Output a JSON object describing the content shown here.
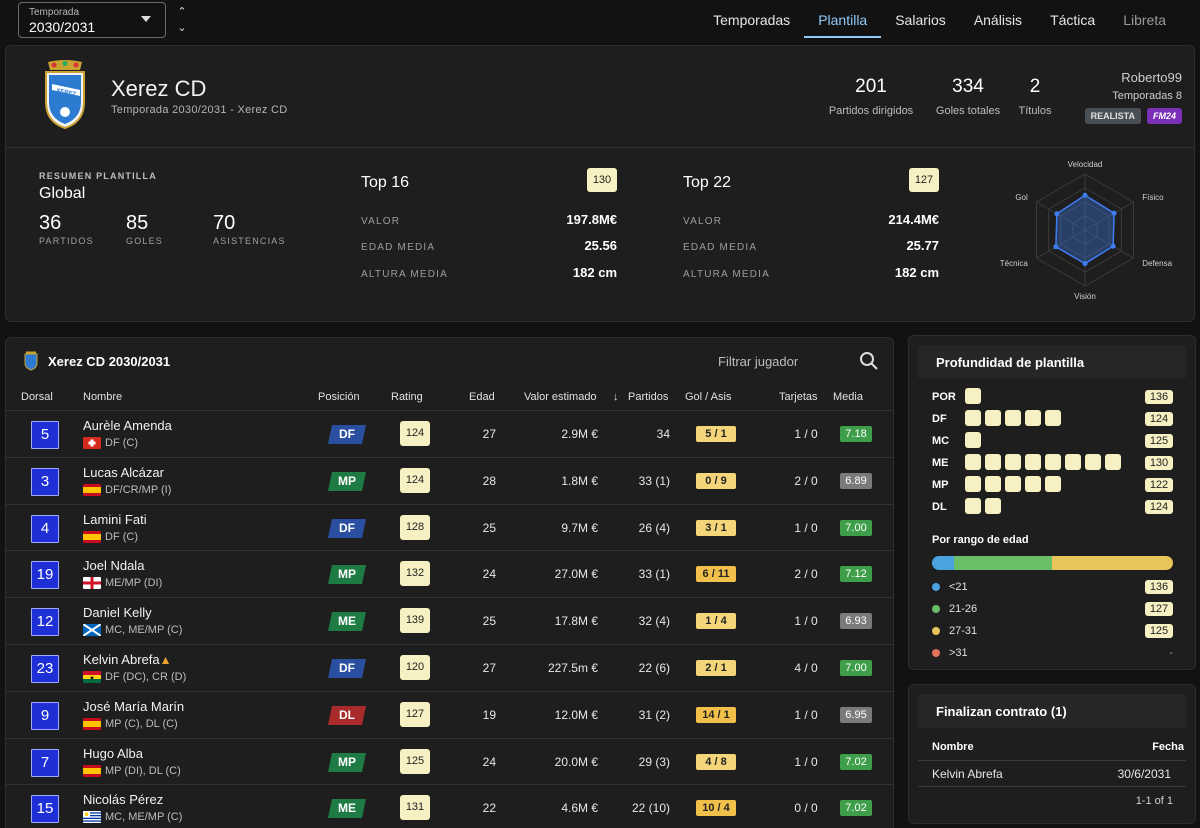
{
  "season": {
    "label": "Temporada",
    "value": "2030/2031"
  },
  "nav": [
    "Temporadas",
    "Plantilla",
    "Salarios",
    "Análisis",
    "Táctica",
    "Libreta"
  ],
  "club": {
    "name": "Xerez CD",
    "subtitle": "Temporada 2030/2031 - Xerez CD",
    "crest_text": "XEREZ"
  },
  "stats": [
    {
      "value": "201",
      "label": "Partidos dirigidos"
    },
    {
      "value": "334",
      "label": "Goles totales"
    },
    {
      "value": "2",
      "label": "Títulos"
    }
  ],
  "user": {
    "name": "Roberto99",
    "seasons": "Temporadas 8",
    "badges": [
      "REALISTA",
      "FM24"
    ]
  },
  "summary": {
    "caption": "RESUMEN PLANTILLA",
    "title": "Global",
    "stats": [
      {
        "value": "36",
        "label": "PARTIDOS"
      },
      {
        "value": "85",
        "label": "GOLES"
      },
      {
        "value": "70",
        "label": "ASISTENCIAS"
      }
    ]
  },
  "tops": [
    {
      "title": "Top 16",
      "rating": "130",
      "rows": [
        {
          "k": "VALOR",
          "v": "197.8M€"
        },
        {
          "k": "EDAD MEDIA",
          "v": "25.56"
        },
        {
          "k": "ALTURA MEDIA",
          "v": "182 cm"
        }
      ]
    },
    {
      "title": "Top 22",
      "rating": "127",
      "rows": [
        {
          "k": "VALOR",
          "v": "214.4M€"
        },
        {
          "k": "EDAD MEDIA",
          "v": "25.77"
        },
        {
          "k": "ALTURA MEDIA",
          "v": "182 cm"
        }
      ]
    }
  ],
  "radar": {
    "axes": [
      "Velocidad",
      "Físico",
      "Defensa",
      "Visión",
      "Técnica",
      "Gol"
    ],
    "values": [
      0.62,
      0.6,
      0.58,
      0.6,
      0.6,
      0.58
    ],
    "color": "#3f7df2"
  },
  "squad": {
    "title": "Xerez CD 2030/2031",
    "filter_placeholder": "Filtrar jugador",
    "columns": [
      "Dorsal",
      "Nombre",
      "Posición",
      "Rating",
      "Edad",
      "Valor estimado",
      "Partidos",
      "Gol / Asis",
      "Tarjetas",
      "Media"
    ],
    "sort_icon": "arrow-down-icon",
    "players": [
      {
        "dorsal": "5",
        "name": "Aurèle Amenda",
        "flag": "ch",
        "pos_text": "DF (C)",
        "pos": "DF",
        "rating": "124",
        "edad": "27",
        "valor": "2.9M €",
        "partidos": "34",
        "golas": "5 / 1",
        "tarjetas": "1 / 0",
        "media": "7.18",
        "warn": false
      },
      {
        "dorsal": "3",
        "name": "Lucas Alcázar",
        "flag": "es",
        "pos_text": "DF/CR/MP (I)",
        "pos": "MP",
        "rating": "124",
        "edad": "28",
        "valor": "1.8M €",
        "partidos": "33 (1)",
        "golas": "0 / 9",
        "tarjetas": "2 / 0",
        "media": "6.89",
        "warn": false
      },
      {
        "dorsal": "4",
        "name": "Lamini Fati",
        "flag": "es",
        "pos_text": "DF (C)",
        "pos": "DF",
        "rating": "128",
        "edad": "25",
        "valor": "9.7M €",
        "partidos": "26 (4)",
        "golas": "3 / 1",
        "tarjetas": "1 / 0",
        "media": "7.00",
        "warn": false
      },
      {
        "dorsal": "19",
        "name": "Joel Ndala",
        "flag": "en",
        "pos_text": "ME/MP (DI)",
        "pos": "MP",
        "rating": "132",
        "edad": "24",
        "valor": "27.0M €",
        "partidos": "33 (1)",
        "golas": "6 / 11",
        "tarjetas": "2 / 0",
        "media": "7.12",
        "warn": false
      },
      {
        "dorsal": "12",
        "name": "Daniel Kelly",
        "flag": "sc",
        "pos_text": "MC, ME/MP (C)",
        "pos": "ME",
        "rating": "139",
        "edad": "25",
        "valor": "17.8M €",
        "partidos": "32 (4)",
        "golas": "1 / 4",
        "tarjetas": "1 / 0",
        "media": "6.93",
        "warn": false
      },
      {
        "dorsal": "23",
        "name": "Kelvin Abrefa",
        "flag": "gh",
        "pos_text": "DF (DC), CR (D)",
        "pos": "DF",
        "rating": "120",
        "edad": "27",
        "valor": "227.5m €",
        "partidos": "22 (6)",
        "golas": "2 / 1",
        "tarjetas": "4 / 0",
        "media": "7.00",
        "warn": true
      },
      {
        "dorsal": "9",
        "name": "José María Marín",
        "flag": "es",
        "pos_text": "MP (C), DL (C)",
        "pos": "DL",
        "rating": "127",
        "edad": "19",
        "valor": "12.0M €",
        "partidos": "31 (2)",
        "golas": "14 / 1",
        "tarjetas": "1 / 0",
        "media": "6.95",
        "warn": false
      },
      {
        "dorsal": "7",
        "name": "Hugo Alba",
        "flag": "es",
        "pos_text": "MP (DI), DL (C)",
        "pos": "MP",
        "rating": "125",
        "edad": "24",
        "valor": "20.0M €",
        "partidos": "29 (3)",
        "golas": "4 / 8",
        "tarjetas": "1 / 0",
        "media": "7.02",
        "warn": false
      },
      {
        "dorsal": "15",
        "name": "Nicolás Pérez",
        "flag": "uy",
        "pos_text": "MC, ME/MP (C)",
        "pos": "ME",
        "rating": "131",
        "edad": "22",
        "valor": "4.6M €",
        "partidos": "22 (10)",
        "golas": "10 / 4",
        "tarjetas": "0 / 0",
        "media": "7.02",
        "warn": false
      }
    ]
  },
  "depth": {
    "title": "Profundidad de plantilla",
    "rows": [
      {
        "pos": "POR",
        "count": 1,
        "rating": "136"
      },
      {
        "pos": "DF",
        "count": 5,
        "rating": "124"
      },
      {
        "pos": "MC",
        "count": 1,
        "rating": "125"
      },
      {
        "pos": "ME",
        "count": 8,
        "rating": "130"
      },
      {
        "pos": "MP",
        "count": 5,
        "rating": "122"
      },
      {
        "pos": "DL",
        "count": 2,
        "rating": "124"
      }
    ],
    "age_title": "Por rango de edad",
    "age_bar": [
      {
        "color": "#4aa3df",
        "fraction": 0.09
      },
      {
        "color": "#6abf69",
        "fraction": 0.41
      },
      {
        "color": "#e8c55a",
        "fraction": 0.5
      }
    ],
    "ages": [
      {
        "range": "<21",
        "color": "#4aa3df",
        "rating": "136"
      },
      {
        "range": "21-26",
        "color": "#6abf69",
        "rating": "127"
      },
      {
        "range": "27-31",
        "color": "#e8c55a",
        "rating": "125"
      },
      {
        "range": ">31",
        "color": "#e2735a",
        "rating": "-"
      }
    ]
  },
  "contract": {
    "title": "Finalizan contrato (1)",
    "col_name": "Nombre",
    "col_date": "Fecha",
    "rows": [
      {
        "name": "Kelvin Abrefa",
        "date": "30/6/2031"
      }
    ],
    "pager": "1-1 of 1"
  }
}
